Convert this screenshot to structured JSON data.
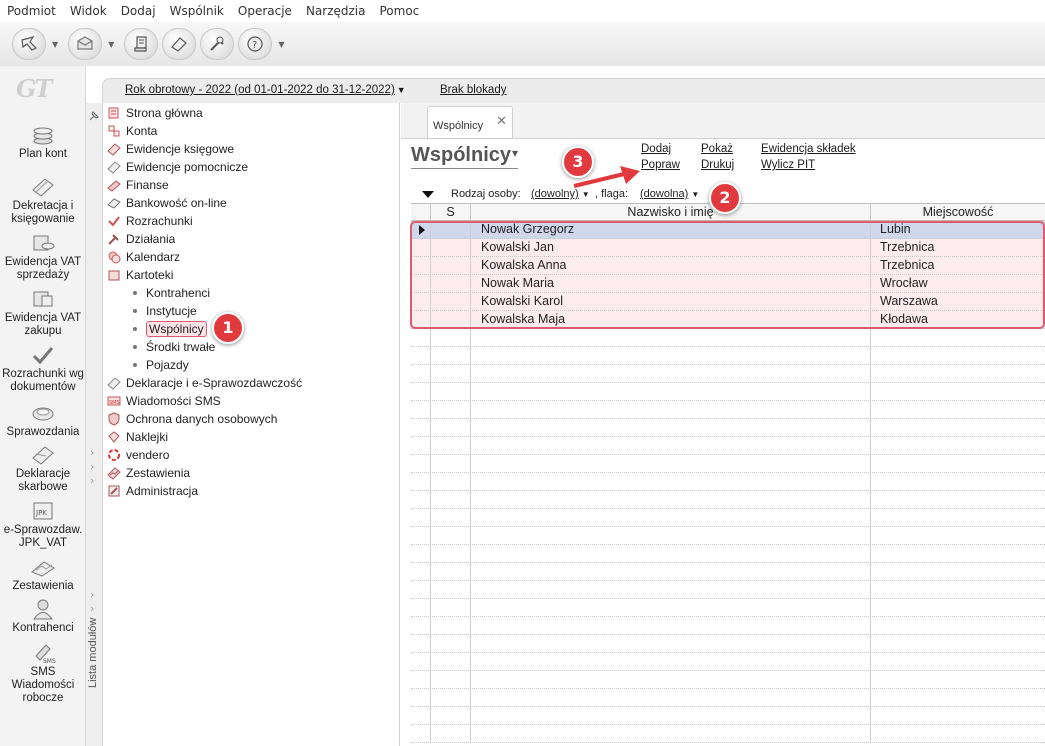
{
  "menu": [
    "Podmiot",
    "Widok",
    "Dodaj",
    "Wspólnik",
    "Operacje",
    "Narzędzia",
    "Pomoc"
  ],
  "toolbar": {
    "buttons": [
      "cursor-icon",
      "envelope-icon",
      "scroll-icon",
      "eraser-icon",
      "tools-icon",
      "help-icon"
    ]
  },
  "info_bar": {
    "fiscal_year": "Rok obrotowy - 2022  (od 01-01-2022 do 31-12-2022)",
    "lock_status": "Brak blokady"
  },
  "left_nav": [
    {
      "label": "Plan kont",
      "icon": "coins-icon"
    },
    {
      "label": "Dekretacja i księgowanie",
      "icon": "documents-icon"
    },
    {
      "label": "Ewidencja VAT sprzedaży",
      "icon": "coins-stack-icon"
    },
    {
      "label": "Ewidencja VAT zakupu",
      "icon": "coins-stack-icon"
    },
    {
      "label": "Rozrachunki wg dokumentów",
      "icon": "checkmark-icon"
    },
    {
      "label": "Sprawozdania",
      "icon": "coins-icon"
    },
    {
      "label": "Deklaracje skarbowe",
      "icon": "documents-icon"
    },
    {
      "label": "e-Sprawozdaw. JPK_VAT",
      "icon": "jpk-icon"
    },
    {
      "label": "Zestawienia",
      "icon": "chart-icon"
    },
    {
      "label": "Kontrahenci",
      "icon": "person-icon"
    },
    {
      "label": "SMS Wiadomości robocze",
      "icon": "sms-icon"
    }
  ],
  "module_strip_label": "Lista modułów",
  "tree": {
    "items": [
      {
        "label": "Strona główna",
        "icon": "home-icon"
      },
      {
        "label": "Konta",
        "icon": "accounts-icon"
      },
      {
        "label": "Ewidencje księgowe",
        "icon": "ledger-icon"
      },
      {
        "label": "Ewidencje pomocnicze",
        "icon": "ledger-icon"
      },
      {
        "label": "Finanse",
        "icon": "finance-icon"
      },
      {
        "label": "Bankowość on-line",
        "icon": "bank-icon"
      },
      {
        "label": "Rozrachunki",
        "icon": "settlement-icon"
      },
      {
        "label": "Działania",
        "icon": "actions-icon"
      },
      {
        "label": "Kalendarz",
        "icon": "calendar-icon"
      },
      {
        "label": "Kartoteki",
        "icon": "cards-icon"
      }
    ],
    "sub_items": [
      "Kontrahenci",
      "Instytucje",
      "Wspólnicy",
      "Środki trwałe",
      "Pojazdy"
    ],
    "items_after": [
      {
        "label": "Deklaracje i e-Sprawozdawczość",
        "icon": "declaration-icon"
      },
      {
        "label": "Wiadomości SMS",
        "icon": "sms-icon"
      },
      {
        "label": "Ochrona danych osobowych",
        "icon": "shield-icon"
      },
      {
        "label": "Naklejki",
        "icon": "sticker-icon"
      },
      {
        "label": "vendero",
        "icon": "vendero-icon"
      },
      {
        "label": "Zestawienia",
        "icon": "chart-icon"
      },
      {
        "label": "Administracja",
        "icon": "admin-icon"
      }
    ]
  },
  "tab": {
    "label": "Wspólnicy",
    "close": "✕"
  },
  "page": {
    "title": "Wspólnicy",
    "caret": "▾",
    "actions": {
      "add": "Dodaj",
      "edit": "Popraw",
      "show": "Pokaż",
      "print": "Drukuj",
      "contributions": "Ewidencja składek",
      "pit": "Wylicz PIT"
    }
  },
  "filters": {
    "person_type_label": "Rodzaj osoby:",
    "person_type_value": "(dowolny)",
    "flag_label": ", flaga:",
    "flag_value": "(dowolna)"
  },
  "grid": {
    "columns": [
      "S",
      "Nazwisko i imię",
      "Miejscowość"
    ],
    "rows": [
      {
        "name": "Nowak Grzegorz",
        "city": "Lubin"
      },
      {
        "name": "Kowalski Jan",
        "city": "Trzebnica"
      },
      {
        "name": "Kowalska Anna",
        "city": "Trzebnica"
      },
      {
        "name": "Nowak Maria",
        "city": "Wrocław"
      },
      {
        "name": "Kowalski Karol",
        "city": "Warszawa"
      },
      {
        "name": "Kowalska Maja",
        "city": "Kłodawa"
      }
    ]
  },
  "annotations": [
    "1",
    "2",
    "3"
  ],
  "colors": {
    "highlight": "#e05a6f",
    "badge": "#e03a3e",
    "selected_row": "#cfd8ea",
    "data_row": "#fcecee"
  }
}
